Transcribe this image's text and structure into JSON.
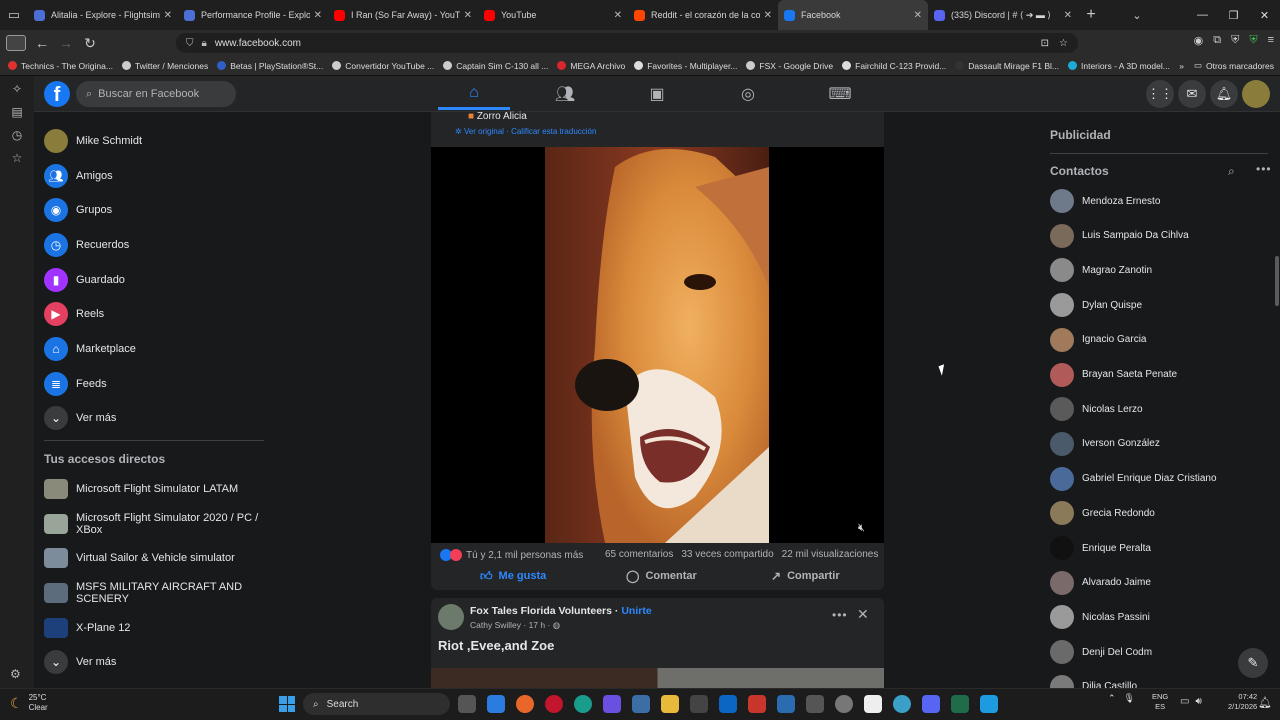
{
  "browser": {
    "tabs": [
      {
        "title": "Alitalia - Explore - Flightsim.to",
        "color": "#4b6fd6",
        "active": false
      },
      {
        "title": "Performance Profile - Explore - ",
        "color": "#4b6fd6",
        "active": false
      },
      {
        "title": "I Ran (So Far Away) - YouTube",
        "color": "#ff0000",
        "active": false
      },
      {
        "title": "YouTube",
        "color": "#ff0000",
        "active": false
      },
      {
        "title": "Reddit - el corazón de la conve",
        "color": "#ff4500",
        "active": false
      },
      {
        "title": "Facebook",
        "color": "#1877f2",
        "active": true
      },
      {
        "title": "(335) Discord | # ⟨ ➔ ▬ ⟩",
        "color": "#5865f2",
        "active": false
      }
    ],
    "url": "www.facebook.com",
    "bookmarks": [
      {
        "label": "Technics - The Origina...",
        "color": "#e03131"
      },
      {
        "label": "Twitter / Menciones",
        "color": "#cccccc"
      },
      {
        "label": "Betas | PlayStation®St...",
        "color": "#2f5ec7"
      },
      {
        "label": "Convertidor YouTube ...",
        "color": "#cccccc"
      },
      {
        "label": "Captain Sim C-130 all ...",
        "color": "#cccccc"
      },
      {
        "label": "MEGA Archivo",
        "color": "#d9272e"
      },
      {
        "label": "Favorites - Multiplayer...",
        "color": "#dddddd"
      },
      {
        "label": "FSX - Google Drive",
        "color": "#cccccc"
      },
      {
        "label": "Fairchild C-123 Provid...",
        "color": "#dddddd"
      },
      {
        "label": "Dassault Mirage F1 Bl...",
        "color": "#333333"
      },
      {
        "label": "Interiors - A 3D model...",
        "color": "#1caad9"
      }
    ],
    "other_bookmarks": "Otros marcadores"
  },
  "facebook": {
    "search_placeholder": "Buscar en Facebook",
    "left_nav": [
      {
        "label": "Mike Schmidt",
        "icon": "profile-avatar",
        "color": "#8a7d3c"
      },
      {
        "label": "Amigos",
        "icon": "friends-icon",
        "color": "#1b74e4"
      },
      {
        "label": "Grupos",
        "icon": "groups-icon",
        "color": "#1b74e4"
      },
      {
        "label": "Recuerdos",
        "icon": "memories-icon",
        "color": "#1b74e4"
      },
      {
        "label": "Guardado",
        "icon": "saved-icon",
        "color": "#a033ff"
      },
      {
        "label": "Reels",
        "icon": "reels-icon",
        "color": "#e4405f"
      },
      {
        "label": "Marketplace",
        "icon": "marketplace-icon",
        "color": "#1b74e4"
      },
      {
        "label": "Feeds",
        "icon": "feeds-icon",
        "color": "#1b74e4"
      },
      {
        "label": "Ver más",
        "icon": "chevron-down-icon",
        "color": "#3a3b3c"
      }
    ],
    "shortcuts_title": "Tus accesos directos",
    "shortcuts": [
      {
        "label": "Microsoft Flight Simulator LATAM",
        "color": "#8a8a7a"
      },
      {
        "label": "Microsoft Flight Simulator 2020 / PC / XBox",
        "color": "#9aa59a"
      },
      {
        "label": "Virtual Sailor & Vehicle simulator",
        "color": "#7c8c9a"
      },
      {
        "label": "MSFS MILITARY AIRCRAFT AND SCENERY",
        "color": "#5c6c7c"
      },
      {
        "label": "X-Plane 12",
        "color": "#1d3f7a"
      },
      {
        "label": "Ver más",
        "color": "#3a3b3c"
      }
    ],
    "post": {
      "author": "Zorro Alicia",
      "translation": "Ver original · Calificar esta traducción",
      "reactions": "Tú y 2,1 mil personas más",
      "comments": "65 comentarios",
      "shares": "33 veces compartido",
      "views": "22 mil visualizaciones",
      "like": "Me gusta",
      "comment": "Comentar",
      "share": "Compartir"
    },
    "post2": {
      "page": "Fox Tales Florida Volunteers",
      "join": "Unirte",
      "sub": "Cathy Swilley · 17 h ·",
      "text": "Riot ,Evee,and Zoe"
    },
    "ads_title": "Publicidad",
    "contacts_title": "Contactos",
    "contacts": [
      {
        "name": "Mendoza Ernesto",
        "color": "#6e7a8a"
      },
      {
        "name": "Luis Sampaio Da Cihlva",
        "color": "#7a6a5a"
      },
      {
        "name": "Magrao Zanotin",
        "color": "#8a8a8a"
      },
      {
        "name": "Dylan Quispe",
        "color": "#9a9a9a"
      },
      {
        "name": "Ignacio Garcia",
        "color": "#a07a5a"
      },
      {
        "name": "Brayan Saeta Penate",
        "color": "#b05a5a"
      },
      {
        "name": "Nicolas Lerzo",
        "color": "#5a5a5a"
      },
      {
        "name": "Iverson González",
        "color": "#4a5a6a"
      },
      {
        "name": "Gabriel Enrique Diaz Cristiano",
        "color": "#4a6a9a"
      },
      {
        "name": "Grecia Redondo",
        "color": "#8a7a5a"
      },
      {
        "name": "Enrique Peralta",
        "color": "#111111"
      },
      {
        "name": "Alvarado Jaime",
        "color": "#7a6a6a"
      },
      {
        "name": "Nicolas Passini",
        "color": "#9a9a9a"
      },
      {
        "name": "Denji Del Codm",
        "color": "#6a6a6a"
      },
      {
        "name": "Dilia Castillo",
        "color": "#7a7a7a"
      }
    ]
  },
  "taskbar": {
    "weather_temp": "25°C",
    "weather_desc": "Clear",
    "search": "Search",
    "lang1": "ENG",
    "lang2": "ES",
    "time": "07:42",
    "date": "2/1/2026"
  }
}
